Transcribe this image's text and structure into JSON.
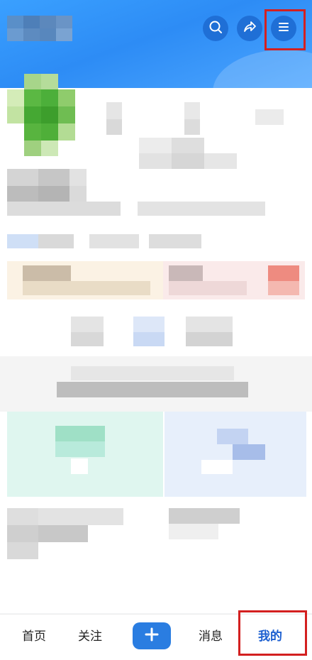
{
  "header": {
    "icons": [
      "search-icon",
      "share-icon",
      "menu-icon"
    ]
  },
  "tabbar": {
    "home": "首页",
    "follow": "关注",
    "create_icon": "plus-icon",
    "messages": "消息",
    "me": "我的"
  },
  "colors": {
    "brand_blue": "#2d8cf5",
    "active_tab": "#1c5fd0",
    "highlight_red": "#d32020"
  }
}
